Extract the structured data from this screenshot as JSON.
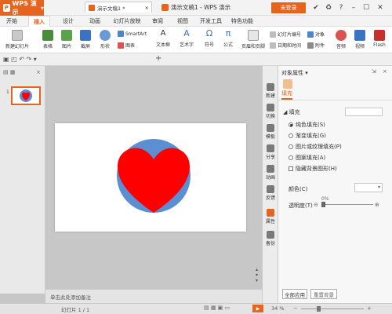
{
  "app": {
    "menu_label": "WPS 演示",
    "logo_char": "P",
    "window_title": "演示文稿1 - WPS 演示",
    "login_label": "未登录"
  },
  "menu_tabs": [
    "开始",
    "插入",
    "设计",
    "动画",
    "幻灯片放映",
    "审阅",
    "视图",
    "开发工具",
    "特色功能"
  ],
  "ribbon": {
    "new_slide": "新建幻灯片",
    "table": "表格",
    "picture": "图片",
    "screenshot": "截屏",
    "shape": "形状",
    "smartart": "SmartArt",
    "chart": "图表",
    "textbox": "文本框",
    "wordart": "艺术字",
    "symbol": "符号",
    "formula": "公式",
    "header_footer": "页眉和页脚",
    "slide_number": "幻灯片编号",
    "object": "对象",
    "datetime": "日期和时间",
    "attachment": "附件",
    "audio": "音频",
    "video": "视频",
    "flash": "Flash",
    "symbol_glyph": "Ω",
    "formula_glyph": "π",
    "textbox_glyph": "A"
  },
  "doc_tab": {
    "label": "演示文稿1 *",
    "close": "×",
    "add": "+"
  },
  "thumbnail": {
    "number": "1"
  },
  "notes_placeholder": "单击此处添加备注",
  "vtoolbar": [
    "新建",
    "切换",
    "模板",
    "分享",
    "动画",
    "反馈",
    "属性",
    "备份"
  ],
  "properties": {
    "title": "对象属性",
    "fill_tab": "填充",
    "section": "填充",
    "options": [
      "纯色填充(S)",
      "渐变填充(G)",
      "图片或纹理填充(P)",
      "图案填充(A)"
    ],
    "hide_bg": "隐藏背景图形(H)",
    "color_label": "颜色(C)",
    "transparency_label": "透明度(T)",
    "transparency_value": "0%",
    "apply_all": "全部应用",
    "reset_bg": "重置背景"
  },
  "status": {
    "slide_info": "幻灯片 1 / 1",
    "zoom": "34 %"
  },
  "colors": {
    "accent": "#e7641e",
    "circle": "#5b8fd1",
    "heart": "#ff0000"
  },
  "icons": [
    "search-icon",
    "close-icon",
    "minimize-icon",
    "maximize-icon",
    "heart-shape",
    "play-icon"
  ]
}
